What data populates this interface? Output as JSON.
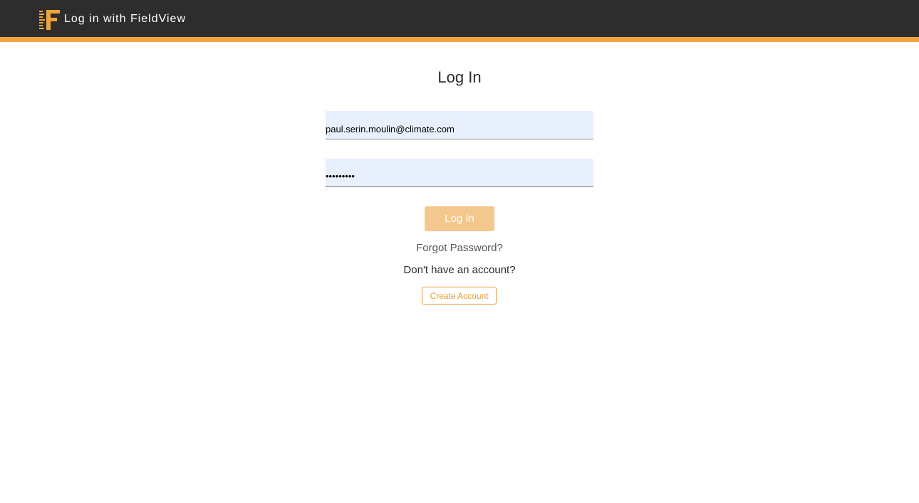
{
  "header": {
    "logo_icon": "fieldview-logo-icon",
    "title": "Log in with FieldView",
    "background_color": "#2d2d2d",
    "accent_color": "#f0a43c"
  },
  "login": {
    "title": "Log In",
    "email_value": "paul.serin.moulin@climate.com",
    "password_value": "•••••••••",
    "submit_label": "Log In",
    "forgot_label": "Forgot Password?",
    "no_account_text": "Don't have an account?",
    "create_account_label": "Create Account"
  }
}
